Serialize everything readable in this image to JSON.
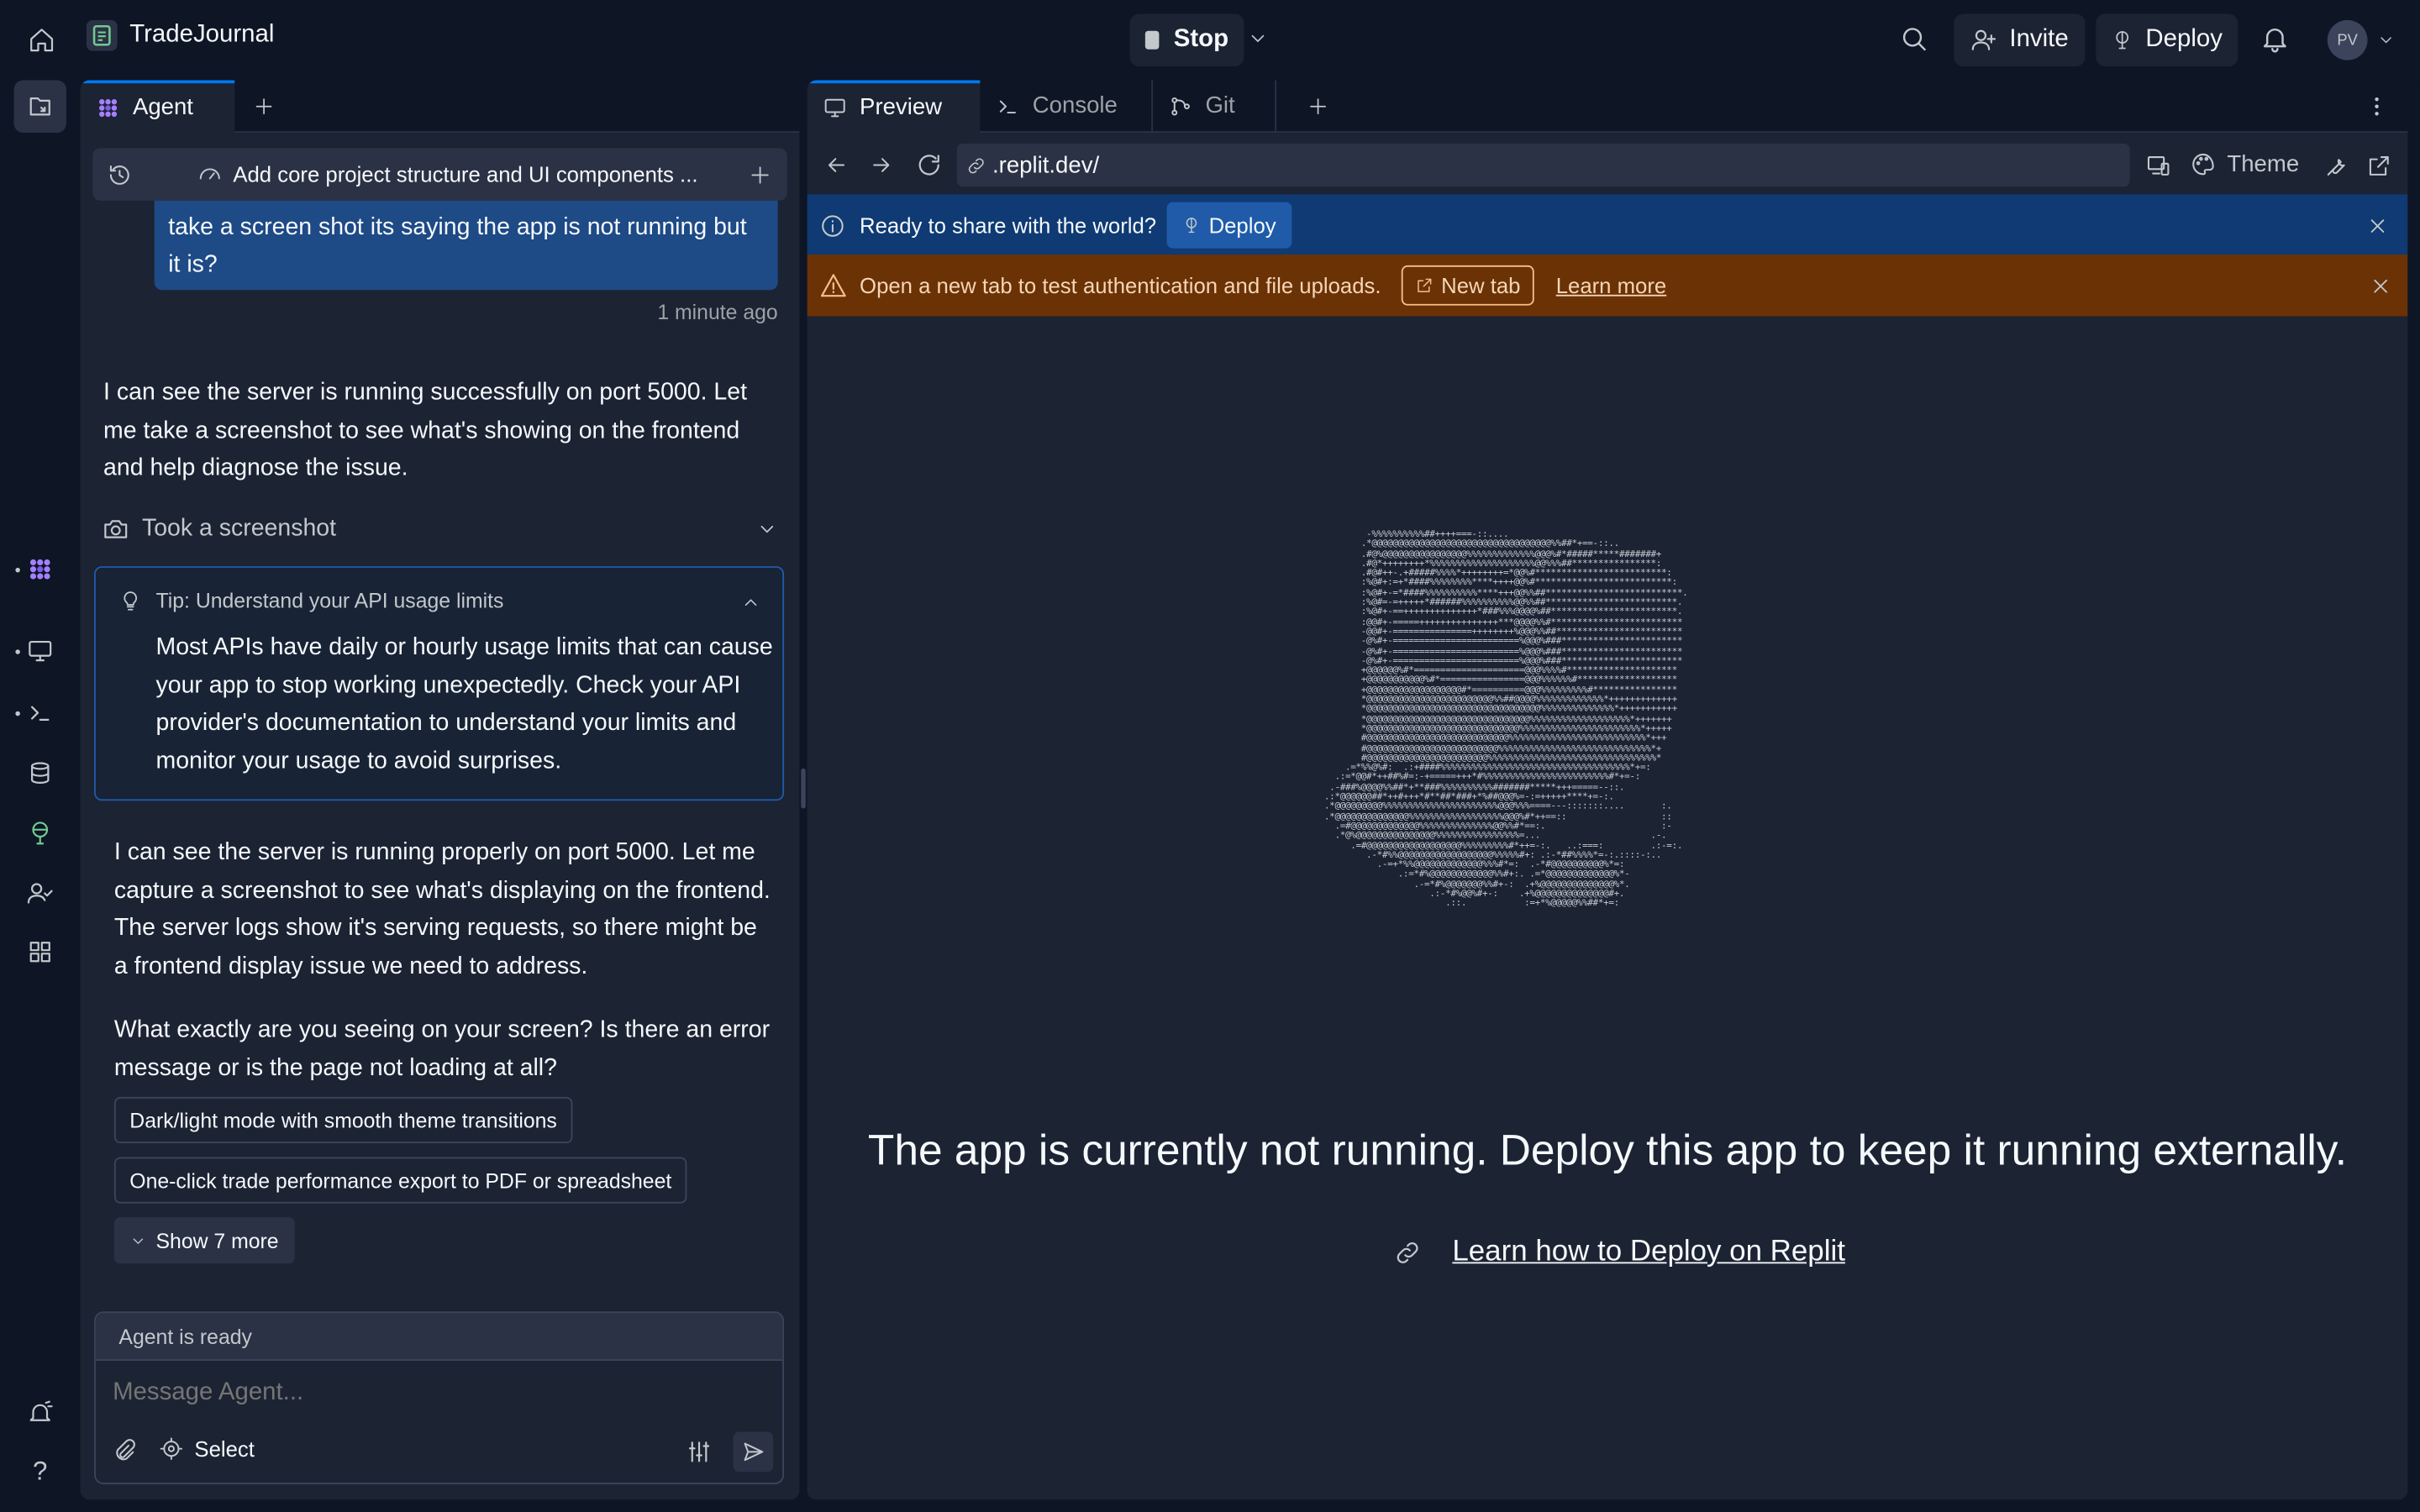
{
  "topbar": {
    "project_name": "TradeJournal",
    "stop_label": "Stop",
    "invite_label": "Invite",
    "deploy_label": "Deploy",
    "avatar_initials": "PV"
  },
  "agent_panel": {
    "tab_label": "Agent",
    "thread_title": "Add core project structure and UI components ...",
    "user_message": "take a screen shot its saying the app is not running but it is?",
    "user_message_time": "1 minute ago",
    "reply_1": "I can see the server is running successfully on port 5000. Let me take a screenshot to see what's showing on the frontend and help diagnose the issue.",
    "action_label": "Took a screenshot",
    "tip": {
      "title": "Tip: Understand your API usage limits",
      "body": "Most APIs have daily or hourly usage limits that can cause your app to stop working unexpectedly. Check your API provider's documentation to understand your limits and monitor your usage to avoid surprises."
    },
    "reply_2": "I can see the server is running properly on port 5000. Let me capture a screenshot to see what's displaying on the frontend. The server logs show it's serving requests, so there might be a frontend display issue we need to address.",
    "reply_3": "What exactly are you seeing on your screen? Is there an error message or is the page not loading at all?",
    "suggestions": [
      "Dark/light mode with smooth theme transitions",
      "One-click trade performance export to PDF or spreadsheet"
    ],
    "show_more_label": "Show 7 more",
    "status": "Agent is ready",
    "input_placeholder": "Message Agent...",
    "select_label": "Select"
  },
  "preview_panel": {
    "tabs": [
      "Preview",
      "Console",
      "Git"
    ],
    "url": ".replit.dev/",
    "theme_label": "Theme",
    "share_banner": {
      "text": "Ready to share with the world?",
      "button": "Deploy"
    },
    "warning_banner": {
      "text": "Open a new tab to test authentication and file uploads.",
      "button": "New tab",
      "link": "Learn more"
    },
    "ascii_art": "        -%%%%%%%%%%##++++===-::....\n       .*@@@@@@@@@@@@@@@@@@@@@@@@@@@@@@@@@@%%##*+==-::..\n       .#@%@@@@@@@@@@@@@@@@%%%%%%%%%%%%%@@@%#*#####*****#######+\n       .#@*++++++++*%%%%%%%%%%%%%%%%%%%%@@%%%##****************:\n       .#@#++-.+#####%%%%*++++++++=*@@%#*************************:\n       :%@#+:=+*####%%%%%%%%****++++@@%#**************************:\n       :%@#+-=*####%%%%%%%%%%****+++@@%%##**************************.\n       :%@#=-=+++++*######%%%%%%%%%%@@%%##*************************.\n       :%@#+-==++++++++++++++*###%%%@@@@%##************************.\n       :@@#+-=====+++++++++++++++***@@@@%%#*************************\n       -@@#+-===============++++++++%@@@%%##************************\n       -@%#+-========================%@@@%###***********************\n       -@%#+-========================%@@@%###***********************\n       -@%#+-========================%@@@%###***********************\n       +@@@@@@%#*=====================@@@%%%%#*********************\n       +@@@@@@@@@@@%#*================@@@%%%%%%#*******************\n       +@@@@@@@@@@@@@@@@@@#*==========@@@%%%%%%%%%#****************\n       *@@@@@@@@@@@@@@@@@@@@@@@@%%##@@@@%%%%%%%%%%%%%*+++++++++++++\n       *@@@@@@@@@@@@@@@@@@@@@@@@@@@@@@@@@%%%%%%%%%%%%%%*+++++++++++\n       *@@@@@@@@@@@@@@@@@@@@@@@@@@@@@@@%%%%%%%%%%%%%%%%%%%*+++++++\n       *@@@@@@@@@@@@@@@@@@@@@@@@@@@@@%%%%%%%%%%%%%%%%%%%%%%%*+++++\n       #@@@@@@@@@@@@@@@@@@@@@@@@@@@%%%%%%%%%%%%%%%%%%%%%%%%%%*+++\n       #@@@@@@@@@@@@@@@@@@@@@@@@@%%%%%%%%%%%%%%%%%%%%%%%%%%%%%*+\n       #@@@@@@@@@@@@@@@@@@@@@@@%%%%%%%%%%%%%%%%%%%%%%%%%%%%%%%%*\n    .=*%%@%#:  .:+####%%%%%%%%%%%%%%%%%%%%%%%%%%%%%%%%%%%%*+=:\n  .:=*@@#*++##%#=:-+=====+++*#%%%%%%%%%%%%%%%%%%%%%%%%#*+=-:\n .-###%@@@@%%##*+**###%%%%%%%%%%#######*****+++=====--::.\n.:*@@@@@@##*++#+++*#**##*###+*%##@@@%=-:=+++++****+=-:.\n.*@@@@@@@@@%%%%%%%%%%%%%%%%%%%%%%@@@%%%====---:::::::....       :.\n.*@@@@@@@@@@@@@@%%%%%%%%%%%%%%%%%%@@@%#*++==::                  ::\n  .=#@@@@@@@@@@@@@%%%%%%%%%%%%%%@@%%#*==:.                      :-\n  .*@%@@@@@@@@@@@@@@@%%%%%%%%%%%%%%%%=...                     .-.\n     .=#@@@@@@@@@@@@@@@@@@%%%%%%%%%#*++=-:.   ..:===:         .:-=:.\n        .-*#%%@@@@@@@@@@@@@@@@@@%%%%%#+: .:-*##%%%%*=-:.::::-:..\n          .-=+*%%@@@@@@@@@@@@@%%%#*=:  .-*#@@@@@@@@@@%*=:\n              .:=*#%@@@@@@@@@@@@%%#+:. .=*@@@@@@@@@@@@@%*-\n                 .-=*#%@@@@@@@%%#+-:  .+%@@@@@@@@@@@@@@%*.\n                    .:-*#%@@%#+-:    .+%@@@@@@@@@@@@@@#+.\n                       .::.           :=+*%@@@@@%%##*+=:",
    "headline": "The app is currently not running. Deploy this app to keep it running externally.",
    "deploy_link": "Learn how to Deploy on Replit"
  }
}
